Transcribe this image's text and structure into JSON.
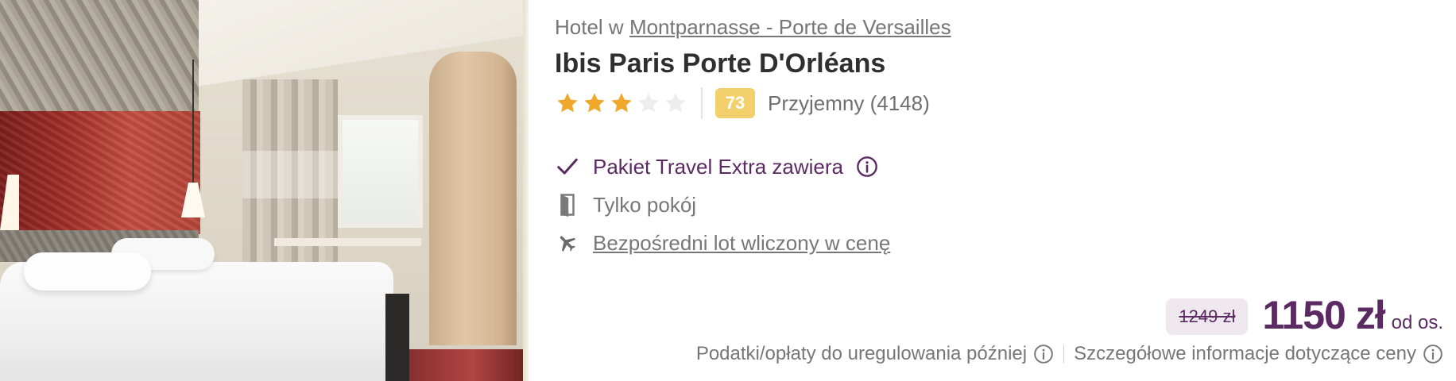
{
  "hotel": {
    "location_prefix": "Hotel w",
    "location_link": "Montparnasse - Porte de Versailles",
    "name": "Ibis Paris Porte D'Orléans",
    "stars": {
      "filled": 3,
      "total": 5
    },
    "score": "73",
    "rating_text": "Przyjemny (4148)"
  },
  "features": {
    "package": "Pakiet Travel Extra zawiera",
    "room": "Tylko pokój",
    "flight": "Bezpośredni lot wliczony w cenę"
  },
  "price": {
    "old": "1249 zł",
    "current": "1150 zł",
    "per": "od os."
  },
  "fees": {
    "taxes": "Podatki/opłaty do uregulowania później",
    "details": "Szczegółowe informacje dotyczące ceny"
  },
  "icons": {
    "star_filled": "star-icon",
    "star_empty": "star-outline-icon",
    "check": "check-icon",
    "door": "door-icon",
    "plane": "plane-icon",
    "info": "info-icon"
  },
  "colors": {
    "brand_purple": "#5b2a63",
    "star": "#f0a82c",
    "score_badge": "#f2d06b"
  }
}
